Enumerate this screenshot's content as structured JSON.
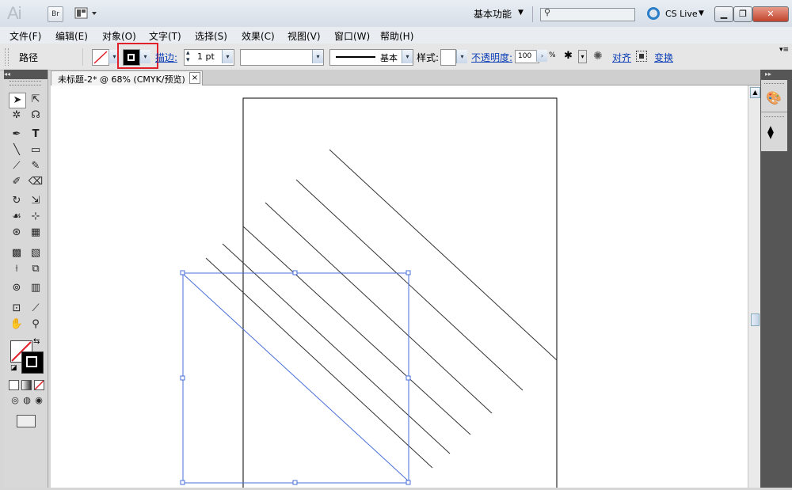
{
  "app": {
    "logo": "Ai",
    "bridge_label": "Br",
    "workspace": "基本功能",
    "cslive": "CS Live"
  },
  "menu": [
    "文件(F)",
    "编辑(E)",
    "对象(O)",
    "文字(T)",
    "选择(S)",
    "效果(C)",
    "视图(V)",
    "窗口(W)",
    "帮助(H)"
  ],
  "control": {
    "object_type": "路径",
    "stroke_link": "描边:",
    "stroke_weight": "1 pt",
    "brush_label": "基本",
    "style_label": "样式:",
    "opacity_link": "不透明度:",
    "opacity_value": "100",
    "opacity_unit": "%",
    "align_link": "对齐",
    "transform_link": "变换",
    "highlight_color": "#e0202a"
  },
  "document": {
    "tab_title": "未标题-2* @ 68% (CMYK/预览)",
    "close": "×"
  },
  "colors": {
    "selection": "#4a6fd8",
    "path_stroke": "#333333"
  }
}
